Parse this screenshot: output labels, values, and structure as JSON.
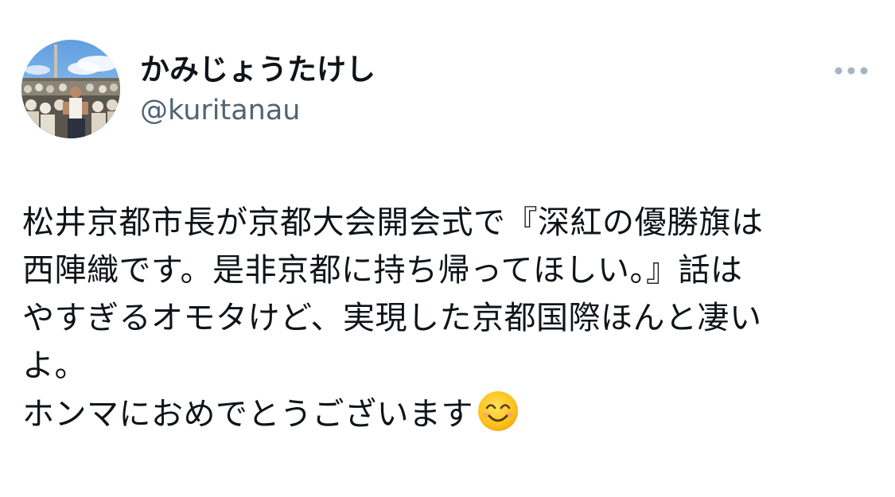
{
  "tweet": {
    "author": {
      "display_name": "かみじょうたけし",
      "handle": "@kuritanau",
      "avatar_icon": "profile-photo"
    },
    "more_icon": "more-horizontal-icon",
    "body_lines": [
      "松井京都市長が京都大会開会式で『深紅の優勝旗は",
      "西陣織です。是非京都に持ち帰ってほしい。』話は",
      "やすぎるオモタけど、実現した京都国際ほんと凄い",
      "よ。",
      "ホンマにおめでとうございます"
    ],
    "emoji": "smiling-face-with-smiling-eyes",
    "colors": {
      "text": "#0f1419",
      "secondary": "#536471",
      "more_dots": "#a8b4bf"
    }
  }
}
